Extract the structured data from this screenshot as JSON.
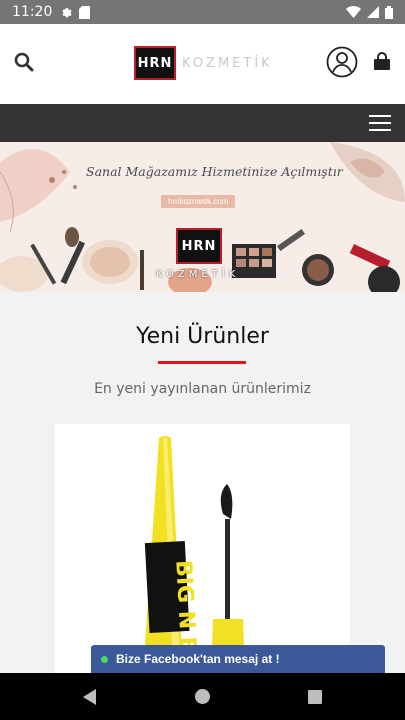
{
  "status_bar": {
    "time": "11:20",
    "icons": [
      "gear-icon",
      "sd-card-icon",
      "wifi-icon",
      "signal-icon",
      "battery-icon"
    ]
  },
  "header": {
    "logo_mark": "HRN",
    "logo_text": "KOZMETİK",
    "icons": [
      "search-icon",
      "user-icon",
      "shopping-bag-icon"
    ]
  },
  "banner": {
    "headline": "Sanal Mağazamız Hizmetinize Açılmıştır",
    "url": "hrnkozmetik.com",
    "logo_mark": "HRN",
    "logo_text": "KOZMETİK"
  },
  "section": {
    "title": "Yeni Ürünler",
    "subtitle": "En yeni yayınlanan ürünlerimiz"
  },
  "product": {
    "package_text": "BIG N BLACK"
  },
  "fb_chat": {
    "label": "Bize Facebook'tan mesaj at !"
  },
  "colors": {
    "accent_red": "#e0141e",
    "navbar": "#333333",
    "fb_blue": "#3b5998"
  }
}
